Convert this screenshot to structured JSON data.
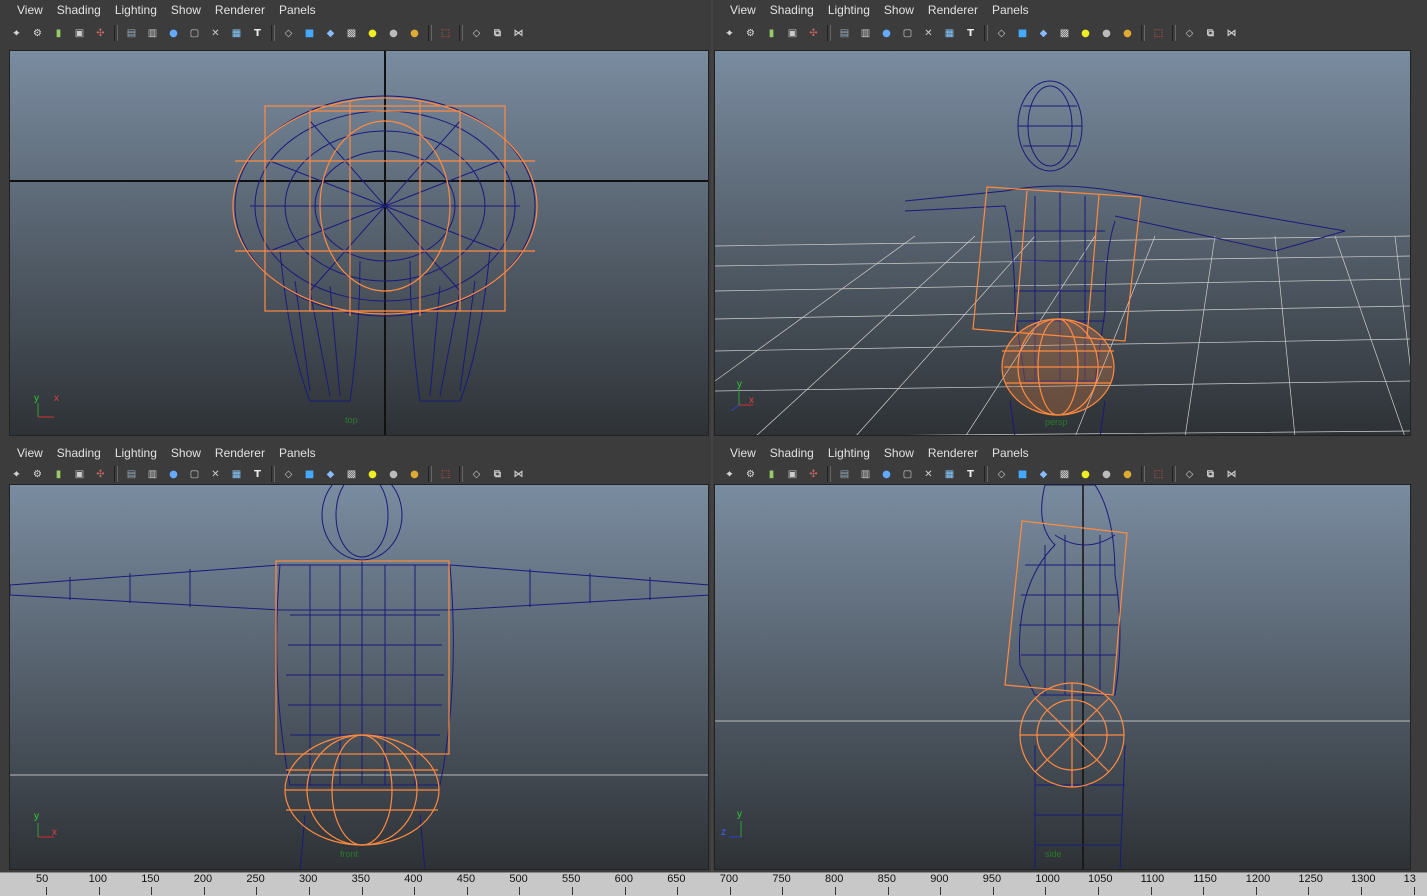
{
  "menus": [
    "View",
    "Shading",
    "Lighting",
    "Show",
    "Renderer",
    "Panels"
  ],
  "toolbar_icons": [
    "camera-select-icon",
    "camera-attr-icon",
    "bookmark-icon",
    "image-plane-icon",
    "grid-pivot-icon",
    "sep",
    "wireframe-icon",
    "film-gate-icon",
    "resolution-gate-icon",
    "gate-mask-icon",
    "field-chart-icon",
    "safe-action-icon",
    "safe-title-icon",
    "sep",
    "wireframe-shade-icon",
    "smooth-shade-icon",
    "wireframe-on-shaded-icon",
    "textured-icon",
    "use-lights-icon",
    "shadows-icon",
    "high-quality-icon",
    "sep",
    "isolate-select-icon",
    "sep",
    "xray-icon",
    "xray-joints-icon",
    "backface-icon"
  ],
  "viewports": [
    {
      "name": "top",
      "label": "top"
    },
    {
      "name": "persp",
      "label": "persp"
    },
    {
      "name": "front",
      "label": "front"
    },
    {
      "name": "side",
      "label": "side"
    }
  ],
  "axis_labels": {
    "x": "x",
    "y": "y",
    "z": "z"
  },
  "timeline": {
    "ticks": [
      "50",
      "100",
      "150",
      "200",
      "250",
      "300",
      "350",
      "400",
      "450",
      "500",
      "550",
      "600",
      "650",
      "700",
      "750",
      "800",
      "850",
      "900",
      "950",
      "1000",
      "1050",
      "1100",
      "1150",
      "1200",
      "1250",
      "1300",
      "13"
    ]
  },
  "colors": {
    "wire": "#1a1a7a",
    "selection": "#ff8a40",
    "bg_top": "#7a8ca0",
    "bg_bottom": "#2a2e32"
  }
}
